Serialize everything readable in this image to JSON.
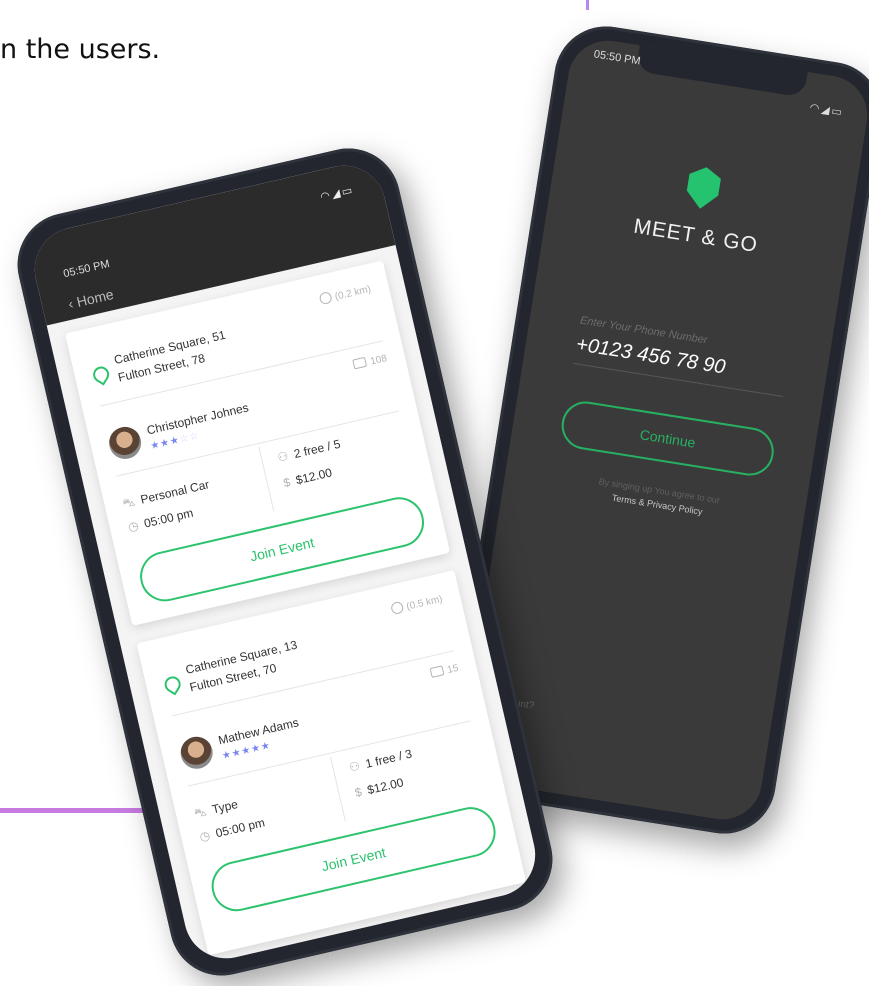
{
  "caption": "n the users.",
  "back_phone": {
    "time": "05:50 PM",
    "status_icons": "wifi signal battery",
    "app_name": "MEET & GO",
    "phone_label": "Enter Your Phone Number",
    "phone_value": "+0123 456 78 90",
    "continue_label": "Continue",
    "terms_line1": "By singing up You agree to our",
    "terms_line2": "Terms & Privacy Policy",
    "account_text": "ccount?",
    "brand_color": "#25c26f"
  },
  "front_phone": {
    "time": "05:50 PM",
    "status_icons": "wifi signal battery",
    "back_label": "Home",
    "events": [
      {
        "address_line1": "Catherine Square, 51",
        "address_line2": "Fulton Street, 78",
        "distance": "(0.2 km)",
        "comments": "108",
        "user_name": "Christopher Johnes",
        "rating": 3,
        "rating_max": 5,
        "transport": "Personal Car",
        "time": "05:00 pm",
        "seats": "2 free / 5",
        "price": "$12.00",
        "join_label": "Join Event"
      },
      {
        "address_line1": "Catherine Square, 13",
        "address_line2": "Fulton Street, 70",
        "distance": "(0.5 km)",
        "comments": "15",
        "user_name": "Mathew Adams",
        "rating": 5,
        "rating_max": 5,
        "transport": "Type",
        "time": "05:00 pm",
        "seats": "1 free / 3",
        "price": "$12.00",
        "join_label": "Join Event"
      }
    ],
    "accent_color": "#2cc36d",
    "star_color": "#7a86f0"
  }
}
